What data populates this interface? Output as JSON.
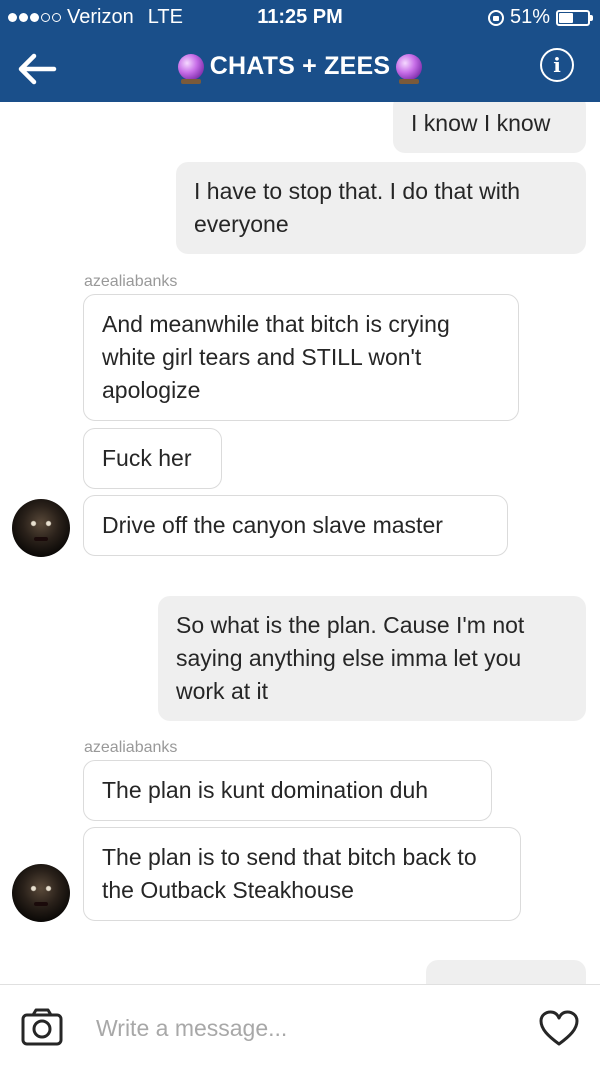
{
  "status_bar": {
    "carrier": "Verizon",
    "network": "LTE",
    "time": "11:25 PM",
    "battery": "51%",
    "battery_level": 0.51
  },
  "header": {
    "title": "CHATS + ZEES",
    "bg_color": "#1a4f8a"
  },
  "messages": [
    {
      "sender": "",
      "text": "I know I know",
      "direction": "outgoing"
    },
    {
      "sender": "",
      "text": "I have to stop that. I do that with everyone",
      "direction": "outgoing"
    },
    {
      "sender": "azealiabanks",
      "text": "And meanwhile that bitch is crying white girl tears and STILL won't apologize",
      "direction": "incoming"
    },
    {
      "sender": "",
      "text": "Fuck her",
      "direction": "incoming"
    },
    {
      "sender": "",
      "text": "Drive off the canyon slave master",
      "direction": "incoming"
    },
    {
      "sender": "",
      "text": "So what is the plan. Cause I'm not saying anything else imma let you work at it",
      "direction": "outgoing"
    },
    {
      "sender": "azealiabanks",
      "text": "The plan is kunt domination duh",
      "direction": "incoming"
    },
    {
      "sender": "",
      "text": "The plan is to send that bitch back to the Outback Steakhouse",
      "direction": "incoming"
    }
  ],
  "sender_labels": [
    "azealiabanks",
    "azealiabanks"
  ],
  "composer": {
    "placeholder": "Write a message..."
  },
  "icons": {
    "back": "arrow-left-icon",
    "info": "info-icon",
    "camera": "camera-icon",
    "like": "heart-icon",
    "title_emoji": "crystal-ball-icon"
  }
}
